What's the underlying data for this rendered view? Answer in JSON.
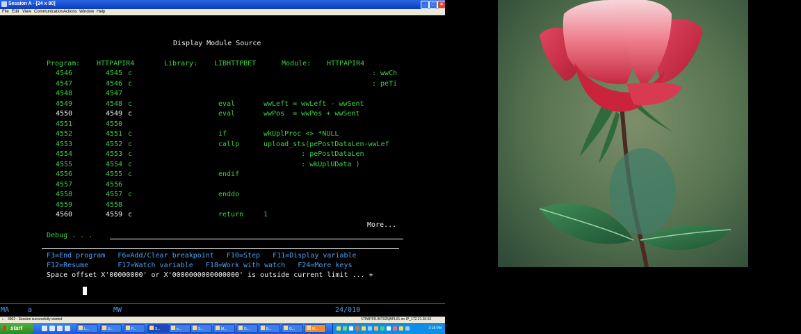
{
  "window": {
    "title": "Session A - [24 x 80]",
    "menu": [
      "File",
      "Edit",
      "View",
      "Communication",
      "Actions",
      "Window",
      "Help"
    ]
  },
  "screen": {
    "header": "Display Module Source",
    "program_label": "Program:",
    "program": "HTTPAPIR4",
    "library_label": "Library:",
    "library": "LIBHTTPBET",
    "module_label": "Module:",
    "module": "HTTPAPIR4",
    "lines": [
      {
        "line": "4546",
        "seq": "4545",
        "c": "c",
        "op": "",
        "text": "",
        "right": ": wwCh"
      },
      {
        "line": "4547",
        "seq": "4546",
        "c": "c",
        "op": "",
        "text": "",
        "right": ": peTi"
      },
      {
        "line": "4548",
        "seq": "4547",
        "c": "",
        "op": "",
        "text": "",
        "right": ""
      },
      {
        "line": "4549",
        "seq": "4548",
        "c": "c",
        "op": "eval",
        "text": "wwLeft = wwLeft - wwSent",
        "right": ""
      },
      {
        "line": "4550",
        "seq": "4549",
        "c": "c",
        "op": "eval",
        "text": "wwPos  = wwPos + wwSent",
        "right": ""
      },
      {
        "line": "4551",
        "seq": "4550",
        "c": "",
        "op": "",
        "text": "",
        "right": ""
      },
      {
        "line": "4552",
        "seq": "4551",
        "c": "c",
        "op": "if",
        "text": "wkUplProc <> *NULL",
        "right": ""
      },
      {
        "line": "4553",
        "seq": "4552",
        "c": "c",
        "op": "callp",
        "text": "upload_sts(pePostDataLen-wwLef",
        "right": ""
      },
      {
        "line": "4554",
        "seq": "4553",
        "c": "c",
        "op": "",
        "text": "         : pePostDataLen",
        "right": ""
      },
      {
        "line": "4555",
        "seq": "4554",
        "c": "c",
        "op": "",
        "text": "         : wkUplUData )",
        "right": ""
      },
      {
        "line": "4556",
        "seq": "4555",
        "c": "c",
        "op": "endif",
        "text": "",
        "right": ""
      },
      {
        "line": "4557",
        "seq": "4556",
        "c": "",
        "op": "",
        "text": "",
        "right": ""
      },
      {
        "line": "4558",
        "seq": "4557",
        "c": "c",
        "op": "enddo",
        "text": "",
        "right": ""
      },
      {
        "line": "4559",
        "seq": "4558",
        "c": "",
        "op": "",
        "text": "",
        "right": ""
      },
      {
        "line": "4560",
        "seq": "4559",
        "c": "c",
        "op": "return",
        "text": "1",
        "right": ""
      }
    ],
    "more": "More...",
    "debug_label": "Debug . . .",
    "fkeys_line1": "F3=End program   F6=Add/Clear breakpoint   F10=Step   F11=Display variable",
    "fkeys_line2": "F12=Resume       F17=Watch variable   F18=Work with watch   F24=More keys",
    "message": "Space offset X'00000000' or X'0000000000000000' is outside current limit ... +"
  },
  "oia": {
    "ma": "MA",
    "a": "a",
    "mw": "MW",
    "cursor_pos": "24/010"
  },
  "status_bar": {
    "left": "3902 - Session successfully started",
    "right": "\\\\TPAPFR.INT025|BPL01 on IP_172.21.30.63"
  },
  "taskbar": {
    "start": "start",
    "tasks": [
      "L...",
      "U...",
      "P...",
      "S...",
      "e...",
      "S...",
      "M...",
      "G...",
      "B...",
      "G...",
      "M..."
    ],
    "clock": "2:18 PM"
  },
  "colors": {
    "screen_green": "#3cd346",
    "screen_white": "#f2f2f2",
    "oia_blue": "#4ea0ee",
    "titlebar_blue": "#0a3bc2"
  }
}
